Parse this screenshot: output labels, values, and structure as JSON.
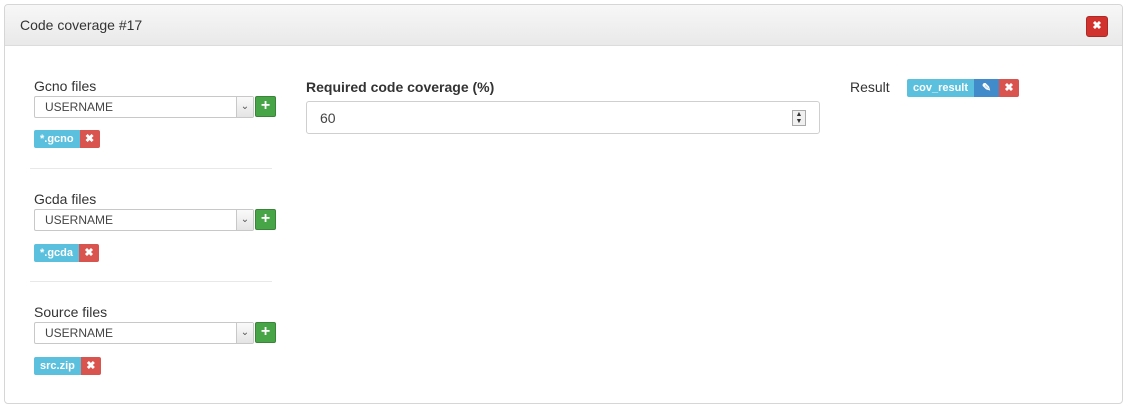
{
  "panel": {
    "title": "Code coverage #17",
    "close_glyph": "✖"
  },
  "gcno": {
    "label": "Gcno files",
    "select_value": "USERNAME",
    "tag": "*.gcno"
  },
  "gcda": {
    "label": "Gcda files",
    "select_value": "USERNAME",
    "tag": "*.gcda"
  },
  "source": {
    "label": "Source files",
    "select_value": "USERNAME",
    "tag": "src.zip"
  },
  "coverage": {
    "label": "Required code coverage (%)",
    "value": "60"
  },
  "result": {
    "label": "Result",
    "tag": "cov_result"
  },
  "icons": {
    "add": "+",
    "remove": "✖",
    "edit": "✎",
    "dropdown": "⌄",
    "spin_up": "▲",
    "spin_down": "▼"
  },
  "colors": {
    "info": "#5bc0de",
    "danger": "#d9534f",
    "success": "#47a447",
    "primary": "#428bca"
  }
}
